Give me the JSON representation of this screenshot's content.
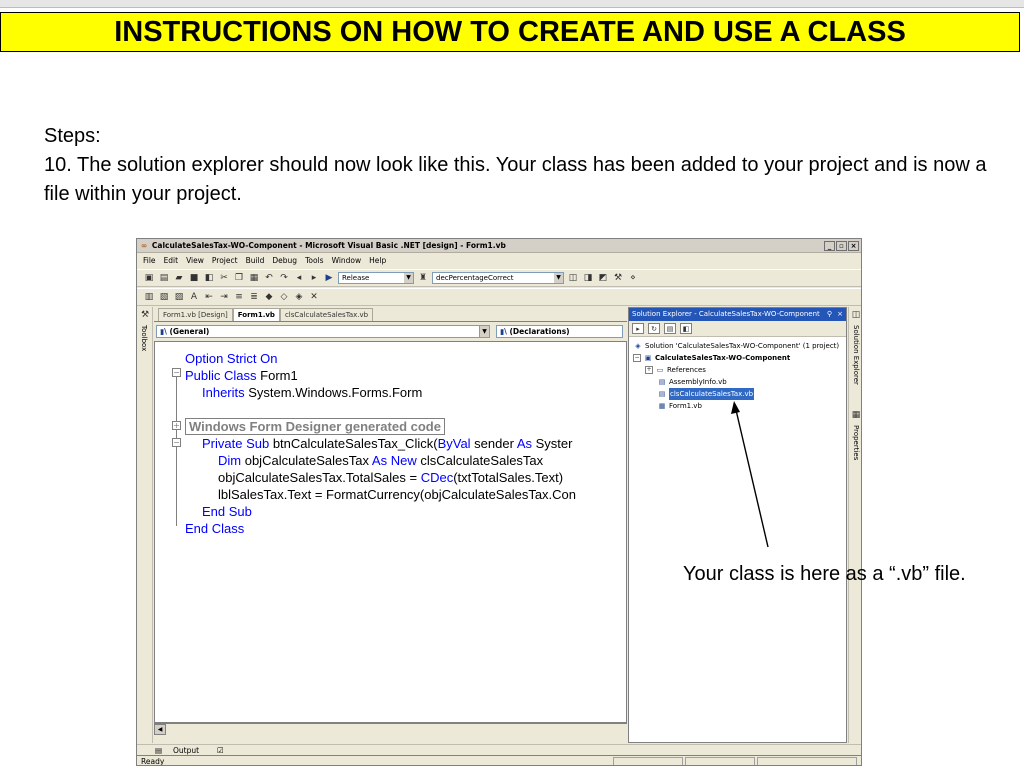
{
  "slide": {
    "title": "INSTRUCTIONS ON HOW TO CREATE AND USE A CLASS",
    "steps_heading": "Steps:",
    "step_text": "10. The solution explorer should now look like this.  Your class has been added to your project and is now a file within your project.",
    "callout": "Your class is here as a “.vb” file."
  },
  "window": {
    "title": "CalculateSalesTax-WO-Component - Microsoft Visual Basic .NET [design] - Form1.vb",
    "controls": [
      "_",
      "▫",
      "×"
    ]
  },
  "menu": [
    "File",
    "Edit",
    "View",
    "Project",
    "Build",
    "Debug",
    "Tools",
    "Window",
    "Help"
  ],
  "toolbar": {
    "config": "Release",
    "find": "decPercentageCorrect"
  },
  "editor": {
    "tabs": [
      "Form1.vb [Design]",
      "Form1.vb",
      "clsCalculateSalesTax.vb"
    ],
    "active_tab": 1,
    "class_dropdown": "(General)",
    "method_dropdown": "(Declarations)",
    "lines": {
      "l1_kw": "Option Strict On",
      "l2_kw": "Public Class",
      "l2_rest": " Form1",
      "l3_kw": "Inherits",
      "l3_rest": " System.Windows.Forms.Form",
      "region": "Windows Form Designer generated code",
      "l5_kw": "Private Sub",
      "l5_rest": " btnCalculateSalesTax_Click(",
      "l5_kw2": "ByVal",
      "l5_rest2": " sender ",
      "l5_kw3": "As",
      "l5_rest3": " Syster",
      "l6_kw": "Dim",
      "l6_rest": " objCalculateSalesTax ",
      "l6_kw2": "As New",
      "l6_rest2": " clsCalculateSalesTax",
      "l7_rest": "objCalculateSalesTax.TotalSales = ",
      "l7_kw": "CDec",
      "l7_rest2": "(txtTotalSales.Text)",
      "l8": "lblSalesTax.Text = FormatCurrency(objCalculateSalesTax.Con",
      "l9_kw": "End Sub",
      "l10_kw": "End Class"
    }
  },
  "solution_explorer": {
    "title": "Solution Explorer - CalculateSalesTax-WO-Component",
    "solution": "Solution 'CalculateSalesTax-WO-Component' (1 project)",
    "project": "CalculateSalesTax-WO-Component",
    "items": [
      "References",
      "AssemblyInfo.vb",
      "clsCalculateSalesTax.vb",
      "Form1.vb"
    ],
    "selected_index": 2
  },
  "side_panels": {
    "toolbox": "Toolbox",
    "solution_explorer": "Solution Explorer",
    "properties": "Properties"
  },
  "bottom": {
    "output_label": "Output",
    "status": "Ready"
  },
  "colors": {
    "title_bg": "#ffff00",
    "keyword": "#0000ff",
    "selection": "#316ac5",
    "panel_title": "#2456b8"
  }
}
